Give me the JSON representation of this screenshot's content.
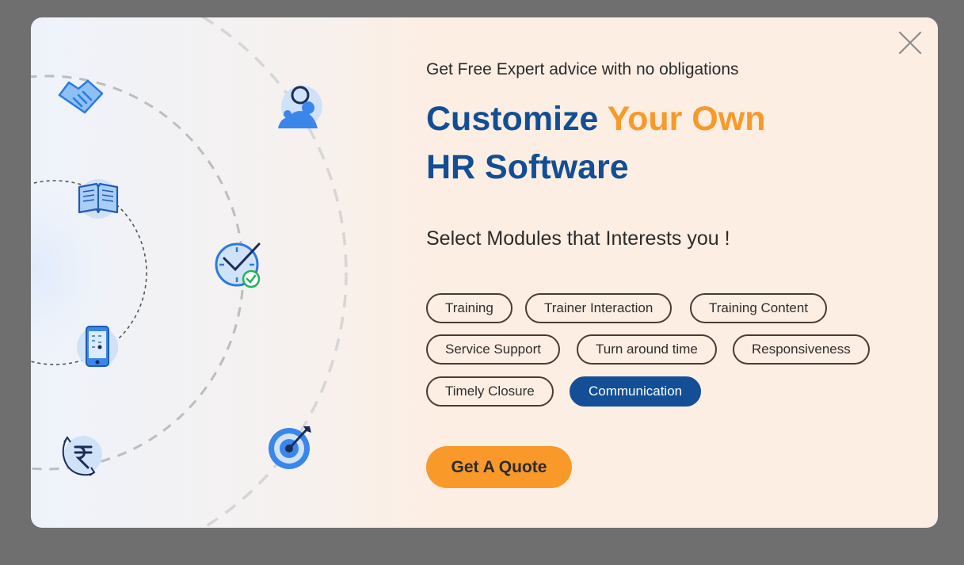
{
  "modal": {
    "eyebrow": "Get Free Expert advice with no obligations",
    "headline_part1": "Customize ",
    "headline_accent": "Your Own",
    "headline_part2": "HR Software",
    "subhead": "Select Modules that Interests you !",
    "modules": [
      {
        "label": "Training",
        "selected": false
      },
      {
        "label": "Trainer Interaction",
        "selected": false
      },
      {
        "label": "Training Content",
        "selected": false
      },
      {
        "label": "Service Support",
        "selected": false
      },
      {
        "label": "Turn around time",
        "selected": false
      },
      {
        "label": "Responsiveness",
        "selected": false
      },
      {
        "label": "Timely Closure",
        "selected": false
      },
      {
        "label": "Communication",
        "selected": true
      }
    ],
    "cta_label": "Get A Quote"
  },
  "icons": {
    "close": "close-icon",
    "art": [
      "handshake-icon",
      "consultant-icon",
      "book-icon",
      "clock-check-icon",
      "mobile-phone-icon",
      "rupee-cycle-icon",
      "target-icon"
    ]
  },
  "colors": {
    "brand_blue": "#134e94",
    "accent_orange": "#f8992a",
    "selected_chip": "#124f96",
    "overlay": "#6f6f6f"
  }
}
